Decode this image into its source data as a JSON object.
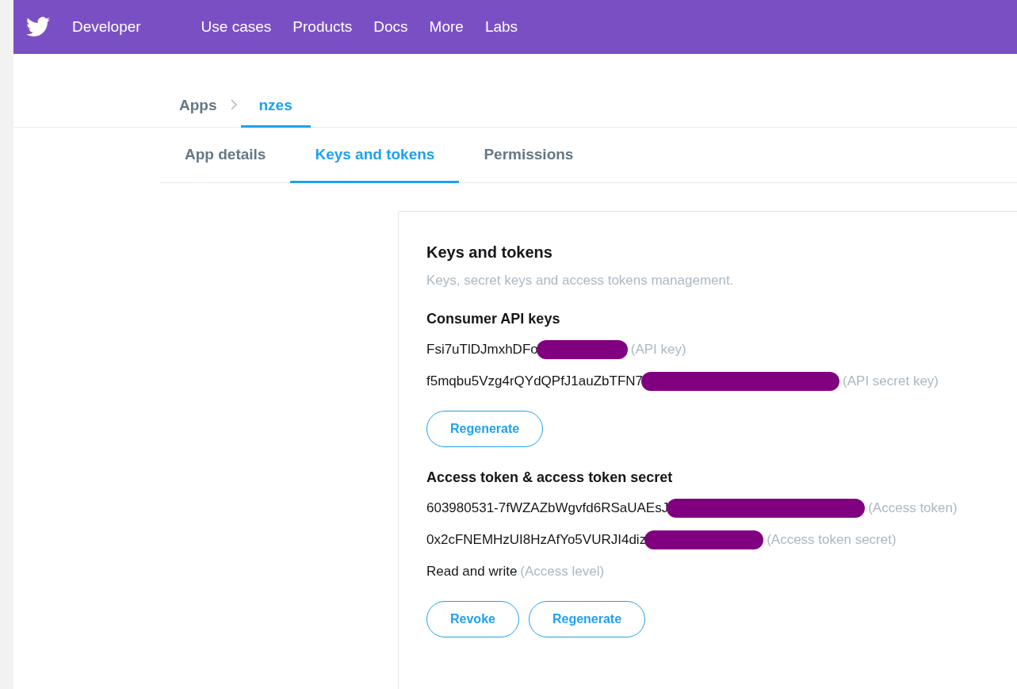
{
  "navbar": {
    "brand": "Developer",
    "links": [
      "Use cases",
      "Products",
      "Docs",
      "More",
      "Labs"
    ]
  },
  "breadcrumb": [
    {
      "label": "Apps",
      "selected": false
    },
    {
      "label": "nzes",
      "selected": true
    }
  ],
  "tabs": [
    {
      "label": "App details",
      "selected": false
    },
    {
      "label": "Keys and tokens",
      "selected": true
    },
    {
      "label": "Permissions",
      "selected": false
    }
  ],
  "card": {
    "title": "Keys and tokens",
    "subtitle": "Keys, secret keys and access tokens management.",
    "sections": [
      {
        "heading": "Consumer API keys",
        "rows": [
          {
            "value": "Fsi7uTlDJmxhDFo",
            "hint": "(API key)",
            "redacted": true
          },
          {
            "value": "f5mqbu5Vzg4rQYdQPfJ1auZbTFN7",
            "hint": "(API secret key)",
            "redacted": true
          }
        ],
        "buttons": [
          "Regenerate"
        ]
      },
      {
        "heading": "Access token & access token secret",
        "rows": [
          {
            "value": "603980531-7fWZAZbWgvfd6RSaUAEsJ",
            "hint": "(Access token)",
            "redacted": true
          },
          {
            "value": "0x2cFNEMHzUI8HzAfYo5VURJI4diz",
            "hint": "(Access token secret)",
            "redacted": true
          },
          {
            "value": "Read and write",
            "hint": "(Access level)",
            "redacted": false
          }
        ],
        "buttons": [
          "Revoke",
          "Regenerate"
        ]
      }
    ]
  }
}
